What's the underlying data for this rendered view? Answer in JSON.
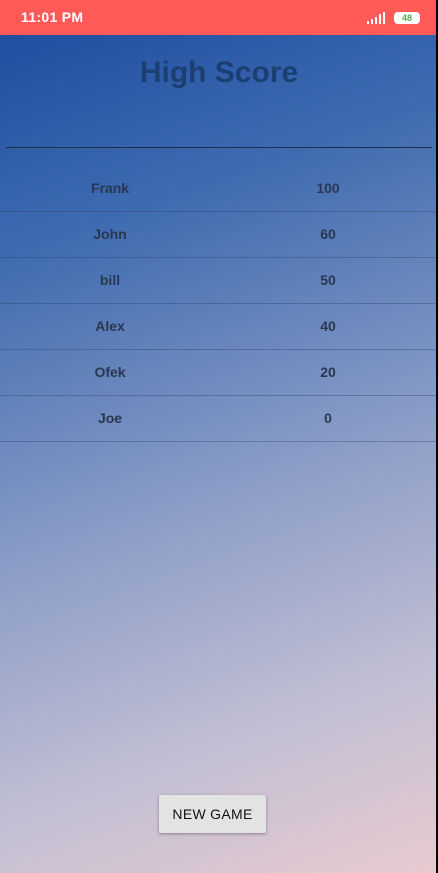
{
  "status_bar": {
    "time": "11:01 PM",
    "battery_level": "48",
    "color": "#ff5a57"
  },
  "screen": {
    "title": "High Score",
    "title_color": "#1c3f73"
  },
  "scores": [
    {
      "name": "Frank",
      "score": "100"
    },
    {
      "name": "John",
      "score": "60"
    },
    {
      "name": "bill",
      "score": "50"
    },
    {
      "name": "Alex",
      "score": "40"
    },
    {
      "name": "Ofek",
      "score": "20"
    },
    {
      "name": "Joe",
      "score": "0"
    }
  ],
  "actions": {
    "new_game_label": "NEW GAME"
  },
  "icons": {
    "signal": "signal-icon",
    "battery": "battery-icon"
  }
}
